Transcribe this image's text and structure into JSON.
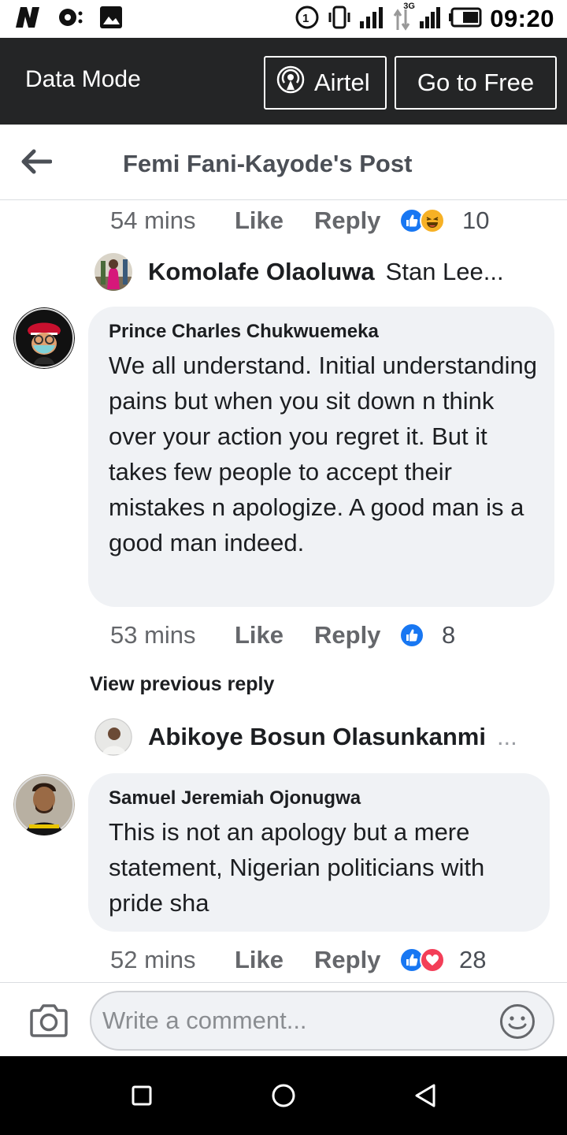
{
  "status_bar": {
    "time": "09:20",
    "icons": [
      "network-n-icon",
      "media-icon",
      "gallery-icon",
      "volte-icon",
      "vibrate-icon",
      "signal-icon",
      "data-3g-icon",
      "signal-icon-2",
      "battery-icon"
    ],
    "network_type": "3G",
    "volte_label": "1"
  },
  "data_bar": {
    "label": "Data Mode",
    "carrier_button": "Airtel",
    "free_button": "Go to Free",
    "background": "#242526"
  },
  "header": {
    "title": "Femi Fani-Kayode's Post"
  },
  "thread": {
    "top_actions": {
      "time": "54 mins",
      "like": "Like",
      "reply": "Reply",
      "reactions": [
        "like",
        "haha"
      ],
      "count": "10"
    },
    "reply_preview_1": {
      "name": "Komolafe Olaoluwa",
      "text": "Stan Lee..."
    },
    "comment_1": {
      "author": "Prince Charles Chukwuemeka",
      "text": "We all understand. Initial understanding pains but when you sit down n think over your action you regret it. But it takes few people to accept their mistakes n apologize. A good man is a good man indeed.",
      "actions": {
        "time": "53 mins",
        "like": "Like",
        "reply": "Reply",
        "reactions": [
          "like"
        ],
        "count": "8"
      }
    },
    "view_previous": "View previous reply",
    "reply_preview_2": {
      "name": "Abikoye Bosun Olasunkanmi",
      "text": "..."
    },
    "comment_2": {
      "author": "Samuel Jeremiah Ojonugwa",
      "text": "This is not an apology but a mere statement, Nigerian politicians with pride sha",
      "actions": {
        "time": "52 mins",
        "like": "Like",
        "reply": "Reply",
        "reactions": [
          "like",
          "love"
        ],
        "count": "28"
      }
    }
  },
  "composer": {
    "placeholder": "Write a comment...",
    "value": ""
  },
  "nav_bar": {
    "buttons": [
      "recents-icon",
      "home-icon",
      "back-icon"
    ]
  },
  "colors": {
    "like_blue": "#1877f2",
    "love_red": "#f33e58",
    "haha_yellow": "#f7b125",
    "secondary_text": "#65676b",
    "bubble": "#f0f2f5"
  }
}
